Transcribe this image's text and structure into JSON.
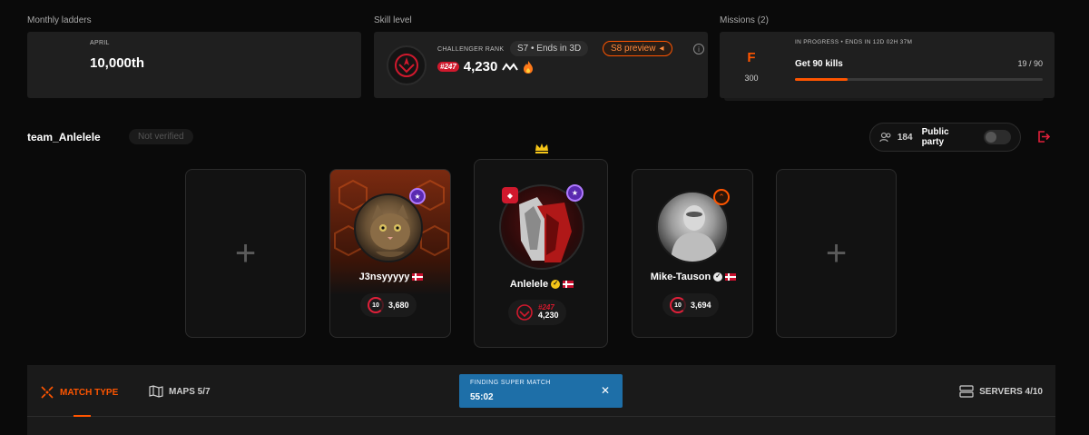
{
  "ladders": {
    "title": "Monthly ladders",
    "month": "APRIL",
    "rank": "10,000th"
  },
  "skill": {
    "title": "Skill level",
    "rank_label": "CHALLENGER RANK",
    "season_pill": "S7 • Ends in 3D",
    "preview_pill": "S8 preview",
    "rank_chip": "#247",
    "elo": "4,230",
    "info_icon": "i"
  },
  "missions": {
    "title": "Missions (2)",
    "letter": "F",
    "points": "300",
    "status": "IN PROGRESS • ENDS IN 12D 02H 37M",
    "name": "Get 90 kills",
    "progress_text": "19 / 90",
    "progress": 0.211
  },
  "team": {
    "name": "team_Anlelele",
    "verify": "Not verified"
  },
  "party": {
    "count": "184",
    "label": "Public party",
    "enabled": false
  },
  "players": [
    {
      "name": "J3nsyyyyy",
      "level": "10",
      "elo": "3,680"
    },
    {
      "name": "Anlelele",
      "rank": "#247",
      "elo": "4,230"
    },
    {
      "name": "Mike-Tauson",
      "level": "10",
      "elo": "3,694"
    }
  ],
  "empty_slot_symbol": "+",
  "bottom": {
    "match_type": "MATCH TYPE",
    "maps": "MAPS 5/7",
    "finding_label": "FINDING SUPER MATCH",
    "finding_time": "55:02",
    "finding_close": "✕",
    "servers": "SERVERS 4/10"
  },
  "colors": {
    "accent": "#ff5500",
    "rank_red": "#d0192d",
    "finding_blue": "#1e6fa8",
    "background": "#0a0a0a",
    "panel": "#1f1f1f"
  }
}
